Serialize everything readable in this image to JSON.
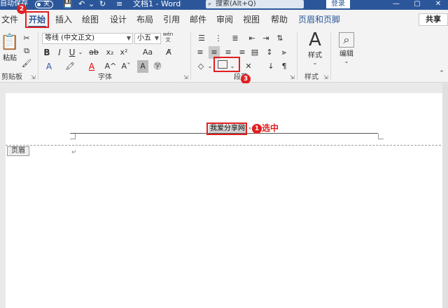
{
  "titlebar": {
    "autosave_label": "自动保存",
    "autosave_state": "关",
    "title": "文档1 - Word",
    "search_placeholder": "搜索(Alt+Q)",
    "login_label": "登录",
    "minimize": "—",
    "restore": "▢",
    "close": "✕"
  },
  "tabs": {
    "file": "文件",
    "home": "开始",
    "insert": "插入",
    "draw": "绘图",
    "design": "设计",
    "layout": "布局",
    "references": "引用",
    "mailings": "邮件",
    "review": "审阅",
    "view": "视图",
    "help": "帮助",
    "header_footer": "页眉和页脚",
    "share": "共享"
  },
  "ribbon": {
    "clipboard": {
      "paste_label": "粘贴",
      "group_label": "剪贴板"
    },
    "font": {
      "font_name": "等线 (中文正文)",
      "font_size": "小五",
      "wen": "wén\n文",
      "bold": "B",
      "italic": "I",
      "underline": "U",
      "strike": "ab",
      "subscript": "x₂",
      "superscript": "x²",
      "text_effect": "A",
      "highlight": "🖍",
      "font_color": "A",
      "case": "Aa",
      "grow": "A^",
      "shrink": "Aˇ",
      "char_shade": "A",
      "enclose": "㊫",
      "clear_format": "A",
      "group_label": "字体"
    },
    "paragraph": {
      "group_label": "段落"
    },
    "styles": {
      "styles_label": "样式",
      "group_label": "样式"
    },
    "editing": {
      "editing_label": "编辑"
    }
  },
  "annotations": {
    "step1": "1",
    "step2": "2",
    "step3": "3",
    "callout_text": "选中"
  },
  "document": {
    "header_text": "我爱分享网",
    "header_tag": "页眉",
    "return_mark": "↵"
  },
  "colors": {
    "accent": "#2b579a",
    "annotation_red": "#e02020"
  }
}
